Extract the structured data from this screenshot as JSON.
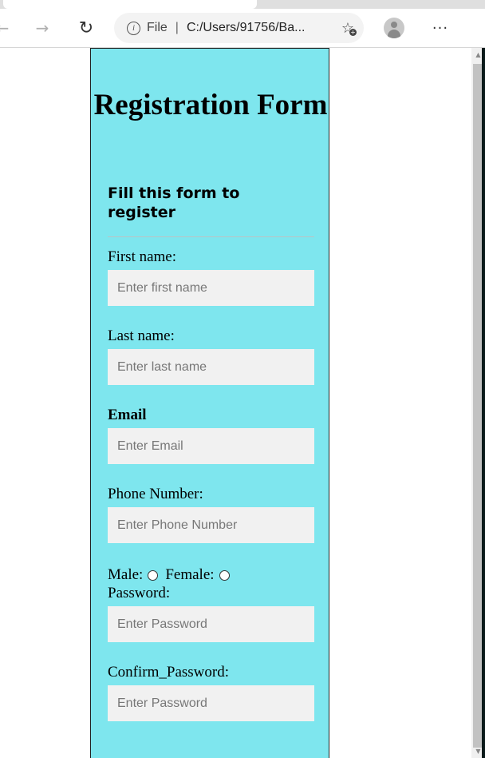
{
  "browser": {
    "address_scheme": "File",
    "address_url": "C:/Users/91756/Ba...",
    "info_symbol": "i",
    "more_label": "···"
  },
  "form": {
    "title": "Registration Form",
    "subtitle": "Fill this form to register",
    "fields": {
      "first_name": {
        "label": "First name:",
        "placeholder": "Enter first name"
      },
      "last_name": {
        "label": "Last name:",
        "placeholder": "Enter last name"
      },
      "email": {
        "label": "Email",
        "placeholder": "Enter Email"
      },
      "phone": {
        "label": "Phone Number:",
        "placeholder": "Enter Phone Number"
      },
      "password": {
        "label": "Password:",
        "placeholder": "Enter Password"
      },
      "confirm_password": {
        "label": "Confirm_Password:",
        "placeholder": "Enter Password"
      }
    },
    "gender": {
      "male_label": "Male:",
      "female_label": "Female:"
    },
    "background_color": "#7ee6ee",
    "input_background": "#f1f1f1"
  }
}
